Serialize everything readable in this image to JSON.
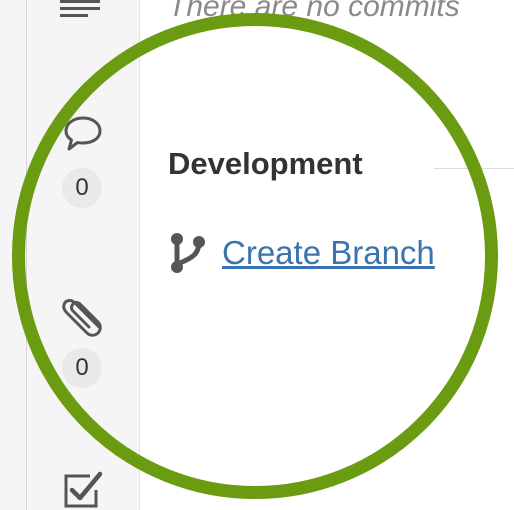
{
  "activity": {
    "empty_message": "There are no commits"
  },
  "sidebar": {
    "comments": {
      "icon": "speech-bubble-icon",
      "count": "0"
    },
    "attachments": {
      "icon": "paperclip-icon",
      "count": "0"
    },
    "checklist": {
      "icon": "checkbox-icon"
    },
    "description": {
      "icon": "text-lines-icon"
    }
  },
  "development": {
    "title": "Development",
    "create_branch": {
      "icon": "branch-icon",
      "label": "Create Branch"
    }
  },
  "colors": {
    "highlight_ring": "#6a9b10",
    "link": "#3b73af",
    "title_text": "#333333",
    "muted_text": "#8a8a8a",
    "sidebar_bg": "#f5f5f5",
    "badge_bg": "#e9e9e9",
    "icon_gray": "#555555"
  }
}
